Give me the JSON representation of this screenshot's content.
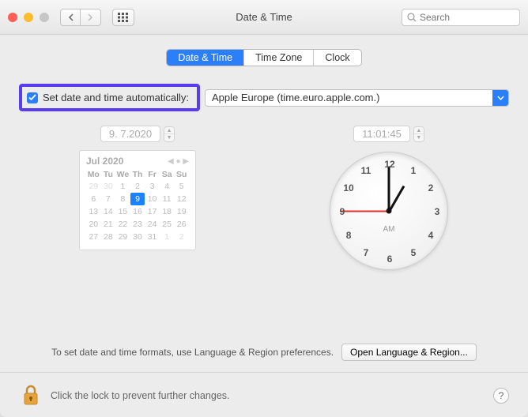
{
  "window": {
    "title": "Date & Time"
  },
  "search": {
    "placeholder": "Search"
  },
  "tabs": {
    "items": [
      "Date & Time",
      "Time Zone",
      "Clock"
    ],
    "active_index": 0
  },
  "auto": {
    "checked": true,
    "label": "Set date and time automatically:",
    "server": "Apple Europe (time.euro.apple.com.)"
  },
  "date_field": "9.  7.2020",
  "time_field": "11:01:45",
  "calendar": {
    "title": "Jul 2020",
    "dow": [
      "Mo",
      "Tu",
      "We",
      "Th",
      "Fr",
      "Sa",
      "Su"
    ],
    "leading": [
      "29",
      "30"
    ],
    "days": [
      "1",
      "2",
      "3",
      "4",
      "5",
      "6",
      "7",
      "8",
      "9",
      "10",
      "11",
      "12",
      "13",
      "14",
      "15",
      "16",
      "17",
      "18",
      "19",
      "20",
      "21",
      "22",
      "23",
      "24",
      "25",
      "26",
      "27",
      "28",
      "29",
      "30",
      "31"
    ],
    "trailing": [
      "1",
      "2"
    ],
    "selected": "9"
  },
  "clock": {
    "numbers": [
      "12",
      "1",
      "2",
      "3",
      "4",
      "5",
      "6",
      "7",
      "8",
      "9",
      "10",
      "11"
    ],
    "ampm": "AM"
  },
  "formats_hint": "To set date and time formats, use Language & Region preferences.",
  "open_lr": "Open Language & Region...",
  "lock_text": "Click the lock to prevent further changes.",
  "help": "?"
}
